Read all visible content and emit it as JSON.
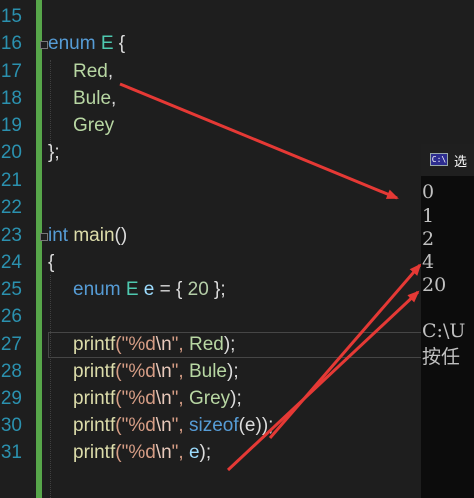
{
  "line_numbers": [
    "15",
    "16",
    "17",
    "18",
    "19",
    "20",
    "21",
    "22",
    "23",
    "24",
    "25",
    "26",
    "27",
    "28",
    "29",
    "30",
    "31"
  ],
  "code": {
    "l16": {
      "kw": "enum",
      "name": "E",
      "brace": " {"
    },
    "l17": {
      "member": "Red",
      "punct": ","
    },
    "l18": {
      "member": "Bule",
      "punct": ","
    },
    "l19": {
      "member": "Grey",
      "punct": ""
    },
    "l20": {
      "text": "};"
    },
    "l23": {
      "kw": "int",
      "name": "main",
      "punct": "()"
    },
    "l24": {
      "text": "{"
    },
    "l25": {
      "kw": "enum",
      "type": "E",
      "var": "e",
      "eq": " = { ",
      "num": "20",
      "end": " };"
    },
    "printf_fn": "printf",
    "fmt_open": "(\"%d",
    "fmt_esc": "\\n",
    "fmt_close": "\", ",
    "l27_arg": "Red",
    "l28_arg": "Bule",
    "l29_arg": "Grey",
    "l30_sizeof": "sizeof",
    "l30_arg": "(e)",
    "l31_arg": "e",
    "stmt_end": ");"
  },
  "console": {
    "title": "选",
    "icon_text": "C:\\",
    "output": [
      "0",
      "1",
      "2",
      "4",
      "20"
    ],
    "prompt": "C:\\U",
    "press_key": "按任"
  },
  "colors": {
    "background": "#1e1e1e",
    "keyword": "#569cd6",
    "enum_member": "#b8d7a3",
    "string": "#d69d85",
    "number": "#b5cea8",
    "line_number": "#2b91af",
    "arrow": "#e53935"
  }
}
